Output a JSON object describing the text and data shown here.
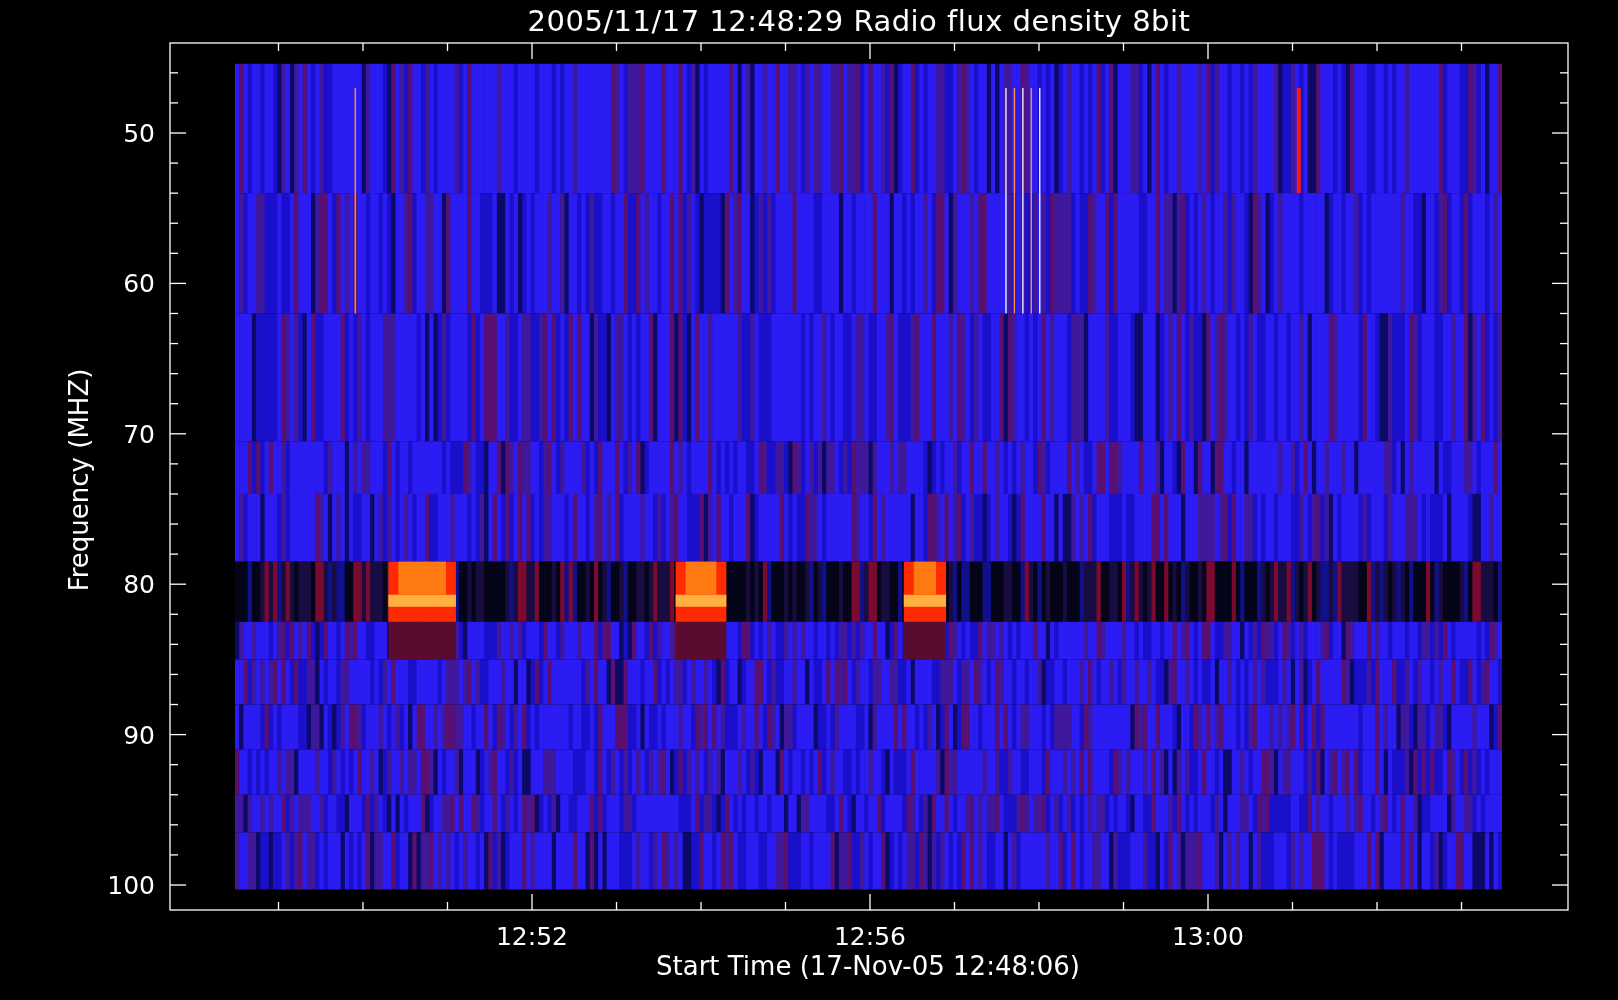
{
  "title": "2005/11/17 12:48:29 Radio flux density 8bit",
  "y_axis": {
    "label": "Frequency (MHZ)",
    "ticks": [
      "50",
      "60",
      "70",
      "80",
      "90",
      "100"
    ]
  },
  "x_axis": {
    "label": "Start Time (17-Nov-05 12:48:06)",
    "ticks": [
      "12:52",
      "12:56",
      "13:00"
    ]
  }
}
